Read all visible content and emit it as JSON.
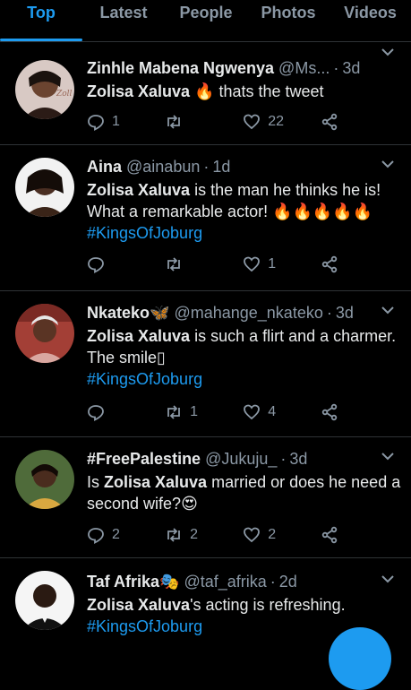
{
  "tabs": [
    "Top",
    "Latest",
    "People",
    "Photos",
    "Videos"
  ],
  "tweets": [
    {
      "name": "Zinhle Mabena Ngwenya",
      "handle": "@Ms...",
      "time": "3d",
      "text_bold": "Zolisa Xaluva",
      "text_rest": " 🔥 thats the tweet",
      "hashtag": "",
      "reply_count": "1",
      "retweet_count": "",
      "like_count": "22"
    },
    {
      "name": "Aina",
      "handle": "@ainabun",
      "time": "1d",
      "text_bold": "Zolisa Xaluva",
      "text_rest": " is the man he thinks he is! What a remarkable actor! 🔥🔥🔥🔥🔥",
      "hashtag": "#KingsOfJoburg",
      "reply_count": "",
      "retweet_count": "",
      "like_count": "1"
    },
    {
      "name": "Nkateko🦋",
      "handle": "@mahange_nkateko",
      "time": "3d",
      "text_bold": "Zolisa Xaluva",
      "text_rest": " is such a flirt and a charmer. The smile▯",
      "hashtag": "#KingsOfJoburg",
      "reply_count": "",
      "retweet_count": "1",
      "like_count": "4"
    },
    {
      "name": "#FreePalestine",
      "handle": "@Jukuju_",
      "time": "3d",
      "text_pre": "Is ",
      "text_bold": "Zolisa Xaluva",
      "text_rest": " married or does he need a second wife?😍",
      "hashtag": "",
      "reply_count": "2",
      "retweet_count": "2",
      "like_count": "2"
    },
    {
      "name": "Taf Afrika🎭",
      "handle": "@taf_afrika",
      "time": "2d",
      "text_bold": "Zolisa Xaluva",
      "text_rest": "'s acting is refreshing.",
      "hashtag": "#KingsOfJoburg",
      "reply_count": "",
      "retweet_count": "",
      "like_count": ""
    }
  ],
  "colors": {
    "accent": "#1d9bf0",
    "background": "#000000",
    "muted": "#8b98a5"
  }
}
